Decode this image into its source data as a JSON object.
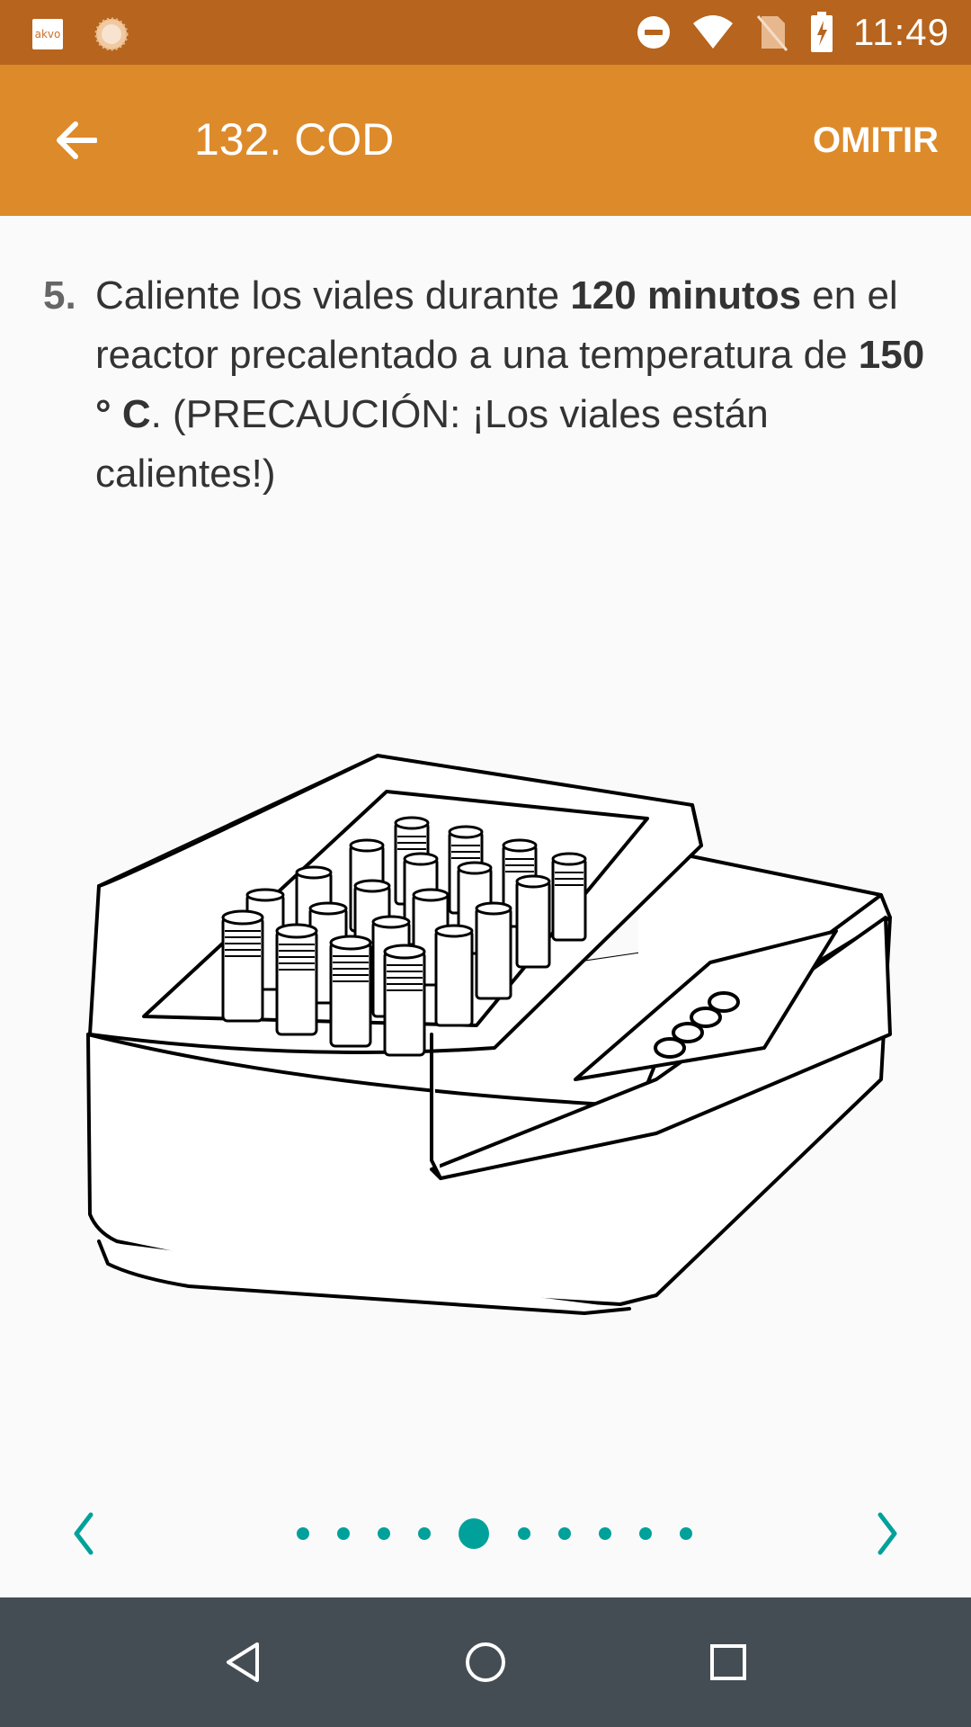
{
  "status_bar": {
    "time": "11:49",
    "app_badge": "akvo",
    "icons": [
      "akvo-icon",
      "sun-icon",
      "do-not-disturb-icon",
      "wifi-icon",
      "no-sim-icon",
      "battery-charging-icon"
    ],
    "background": "#B6641E"
  },
  "app_bar": {
    "title": "132. COD",
    "skip_label": "OMITIR",
    "back_icon": "arrow-left-icon",
    "background": "#DD8A2B"
  },
  "instruction": {
    "number": "5.",
    "parts": {
      "p1": "Caliente los viales durante ",
      "b1": "120 minutos",
      "p2": " en el reactor precalentado a una temperatura de ",
      "b2": "150 ° C",
      "p3": ". (PRECAUCIÓN: ¡Los viales están calientes!)"
    }
  },
  "illustration": {
    "subject": "COD reactor with heated vials",
    "icon": "reactor-illustration"
  },
  "pager": {
    "total_pages": 10,
    "current_page": 5,
    "prev_icon": "chevron-left-icon",
    "next_icon": "chevron-right-icon",
    "accent": "#00A19A"
  },
  "nav_bar": {
    "buttons": [
      "back-triangle-icon",
      "home-circle-icon",
      "recents-square-icon"
    ],
    "background": "#454D54"
  }
}
